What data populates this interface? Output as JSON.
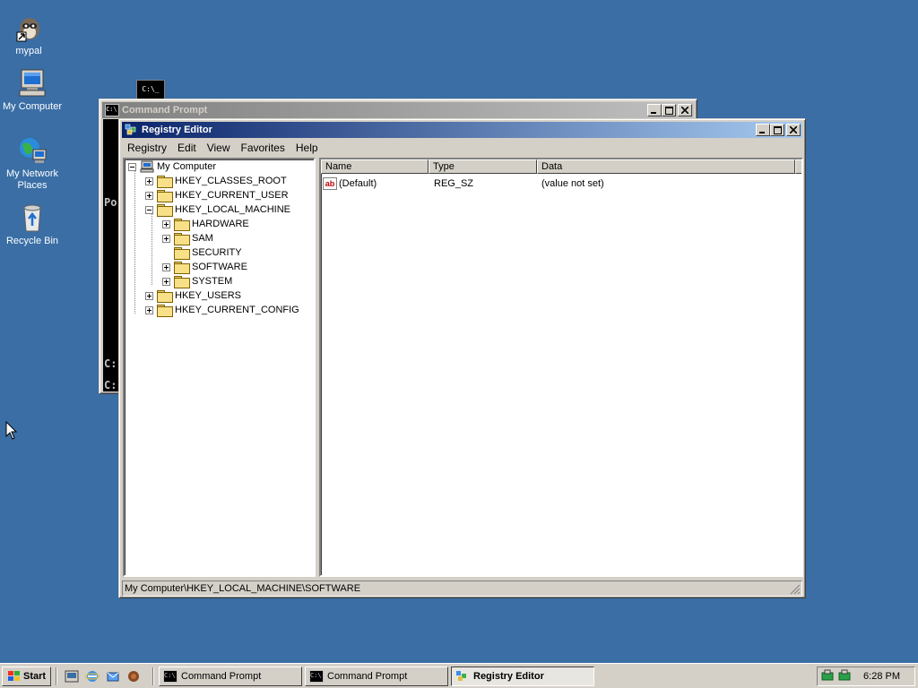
{
  "desktop": {
    "icons": [
      {
        "label": "mypal"
      },
      {
        "label": "My Computer"
      },
      {
        "label": "My Network Places"
      },
      {
        "label": "Recycle Bin"
      }
    ],
    "floating_cmd_icon_text": "C:\\_"
  },
  "cmd_window": {
    "title": "Command Prompt",
    "visible_text": [
      "Po",
      "C:",
      "C:"
    ]
  },
  "regedit": {
    "title": "Registry Editor",
    "menu": [
      "Registry",
      "Edit",
      "View",
      "Favorites",
      "Help"
    ],
    "tree": [
      {
        "label": "My Computer",
        "expander": "minus"
      },
      {
        "label": "HKEY_CLASSES_ROOT",
        "expander": "plus"
      },
      {
        "label": "HKEY_CURRENT_USER",
        "expander": "plus"
      },
      {
        "label": "HKEY_LOCAL_MACHINE",
        "expander": "minus"
      },
      {
        "label": "HARDWARE",
        "expander": "plus"
      },
      {
        "label": "SAM",
        "expander": "plus"
      },
      {
        "label": "SECURITY",
        "expander": "none"
      },
      {
        "label": "SOFTWARE",
        "expander": "plus",
        "selected": true
      },
      {
        "label": "SYSTEM",
        "expander": "plus"
      },
      {
        "label": "HKEY_USERS",
        "expander": "plus"
      },
      {
        "label": "HKEY_CURRENT_CONFIG",
        "expander": "plus"
      }
    ],
    "columns": [
      "Name",
      "Type",
      "Data"
    ],
    "values": [
      {
        "name": "(Default)",
        "type": "REG_SZ",
        "data": "(value not set)",
        "icon": "ab"
      }
    ],
    "status": "My Computer\\HKEY_LOCAL_MACHINE\\SOFTWARE"
  },
  "taskbar": {
    "start_label": "Start",
    "tasks": [
      {
        "label": "Command Prompt",
        "active": false
      },
      {
        "label": "Command Prompt",
        "active": false
      },
      {
        "label": "Registry Editor",
        "active": true
      }
    ],
    "clock": "6:28 PM"
  }
}
